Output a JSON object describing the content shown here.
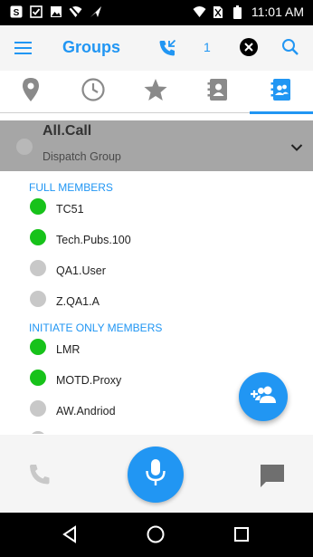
{
  "status_bar": {
    "time": "11:01 AM",
    "left_icons": [
      "notification-s-icon",
      "checkbox-icon",
      "image-icon",
      "wifi-off-icon",
      "send-icon"
    ],
    "right_icons": [
      "wifi-icon",
      "no-sim-icon",
      "battery-icon"
    ]
  },
  "toolbar": {
    "title": "Groups",
    "call_count": "1",
    "accent_color": "#2196f3"
  },
  "tabs": [
    {
      "name": "location",
      "icon": "location-pin-icon",
      "active": false
    },
    {
      "name": "recent",
      "icon": "clock-icon",
      "active": false
    },
    {
      "name": "favorites",
      "icon": "star-icon",
      "active": false
    },
    {
      "name": "contacts",
      "icon": "contacts-book-icon",
      "active": false
    },
    {
      "name": "groups",
      "icon": "group-contacts-icon",
      "active": true
    }
  ],
  "group": {
    "name": "All.Call",
    "type": "Dispatch Group"
  },
  "sections": {
    "full_members_title": "FULL MEMBERS",
    "initiate_only_title": "INITIATE ONLY MEMBERS"
  },
  "full_members": [
    {
      "name": "TC51",
      "status": "online"
    },
    {
      "name": "Tech.Pubs.100",
      "status": "online"
    },
    {
      "name": "QA1.User",
      "status": "offline"
    },
    {
      "name": "Z.QA1.A",
      "status": "offline"
    }
  ],
  "initiate_members": [
    {
      "name": "LMR",
      "status": "online"
    },
    {
      "name": "MOTD.Proxy",
      "status": "online"
    },
    {
      "name": "AW.Andriod",
      "status": "offline"
    }
  ],
  "colors": {
    "online": "#17c21a",
    "offline": "#c8c8c8",
    "accent": "#2196f3",
    "header_bg": "#a6a6a6"
  }
}
